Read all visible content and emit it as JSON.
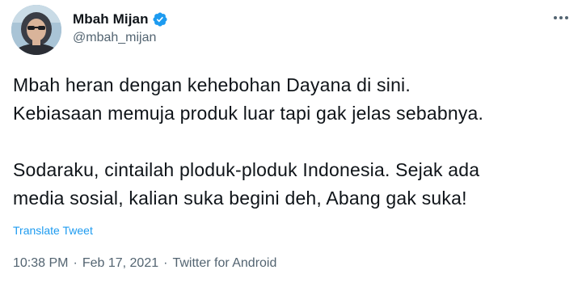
{
  "author": {
    "display_name": "Mbah Mijan",
    "handle": "@mbah_mijan",
    "verified": true
  },
  "tweet": {
    "lines_paragraph_1": [
      "Mbah heran dengan kehebohan Dayana di sini.",
      "Kebiasaan memuja produk luar tapi gak jelas sebabnya."
    ],
    "lines_paragraph_2": [
      "Sodaraku, cintailah ploduk-ploduk Indonesia. Sejak ada",
      "media sosial, kalian suka begini deh, Abang gak suka!"
    ],
    "translate_label": "Translate Tweet"
  },
  "meta": {
    "time": "10:38 PM",
    "separator": "·",
    "date": "Feb 17, 2021",
    "source": "Twitter for Android"
  },
  "icons": {
    "verified": "verified-badge-icon",
    "more": "more-options-icon",
    "avatar": "profile-avatar"
  },
  "colors": {
    "accent": "#1d9bf0",
    "text_primary": "#0f1419",
    "text_secondary": "#536471"
  }
}
